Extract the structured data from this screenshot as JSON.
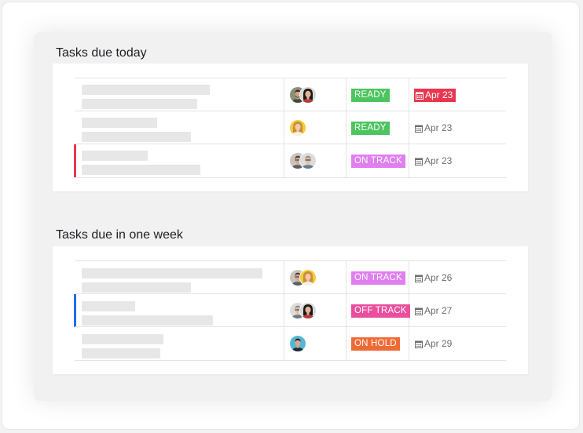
{
  "colors": {
    "ready": "#4cc45f",
    "on_track": "#e07ff0",
    "off_track": "#ea4e9d",
    "on_hold": "#f06a35",
    "overdue": "#e8384f",
    "indicator_red": "#e8384f",
    "indicator_blue": "#1f6feb"
  },
  "sections": [
    {
      "title": "Tasks due today",
      "rows": [
        {
          "status": "READY",
          "status_key": "ready",
          "date": "Apr 23",
          "date_style": "overdue",
          "indicator": "",
          "avatars": [
            "man-beard-icon",
            "woman-dark-hair-icon"
          ]
        },
        {
          "status": "READY",
          "status_key": "ready",
          "date": "Apr 23",
          "date_style": "normal",
          "indicator": "",
          "avatars": [
            "woman-blonde-icon"
          ]
        },
        {
          "status": "ON TRACK",
          "status_key": "on_track",
          "date": "Apr 23",
          "date_style": "normal",
          "indicator": "red",
          "avatars": [
            "man-glasses-icon",
            "man-gray-icon"
          ]
        }
      ]
    },
    {
      "title": "Tasks due in one week",
      "rows": [
        {
          "status": "ON TRACK",
          "status_key": "on_track",
          "date": "Apr 26",
          "date_style": "normal",
          "indicator": "",
          "avatars": [
            "man-glasses-icon",
            "woman-blonde-icon"
          ]
        },
        {
          "status": "OFF TRACK",
          "status_key": "off_track",
          "date": "Apr 27",
          "date_style": "normal",
          "indicator": "blue",
          "avatars": [
            "man-gray-icon",
            "woman-dark-hair-icon"
          ]
        },
        {
          "status": "ON HOLD",
          "status_key": "on_hold",
          "date": "Apr 29",
          "date_style": "normal",
          "indicator": "",
          "avatars": [
            "man-teal-icon"
          ]
        }
      ]
    }
  ]
}
